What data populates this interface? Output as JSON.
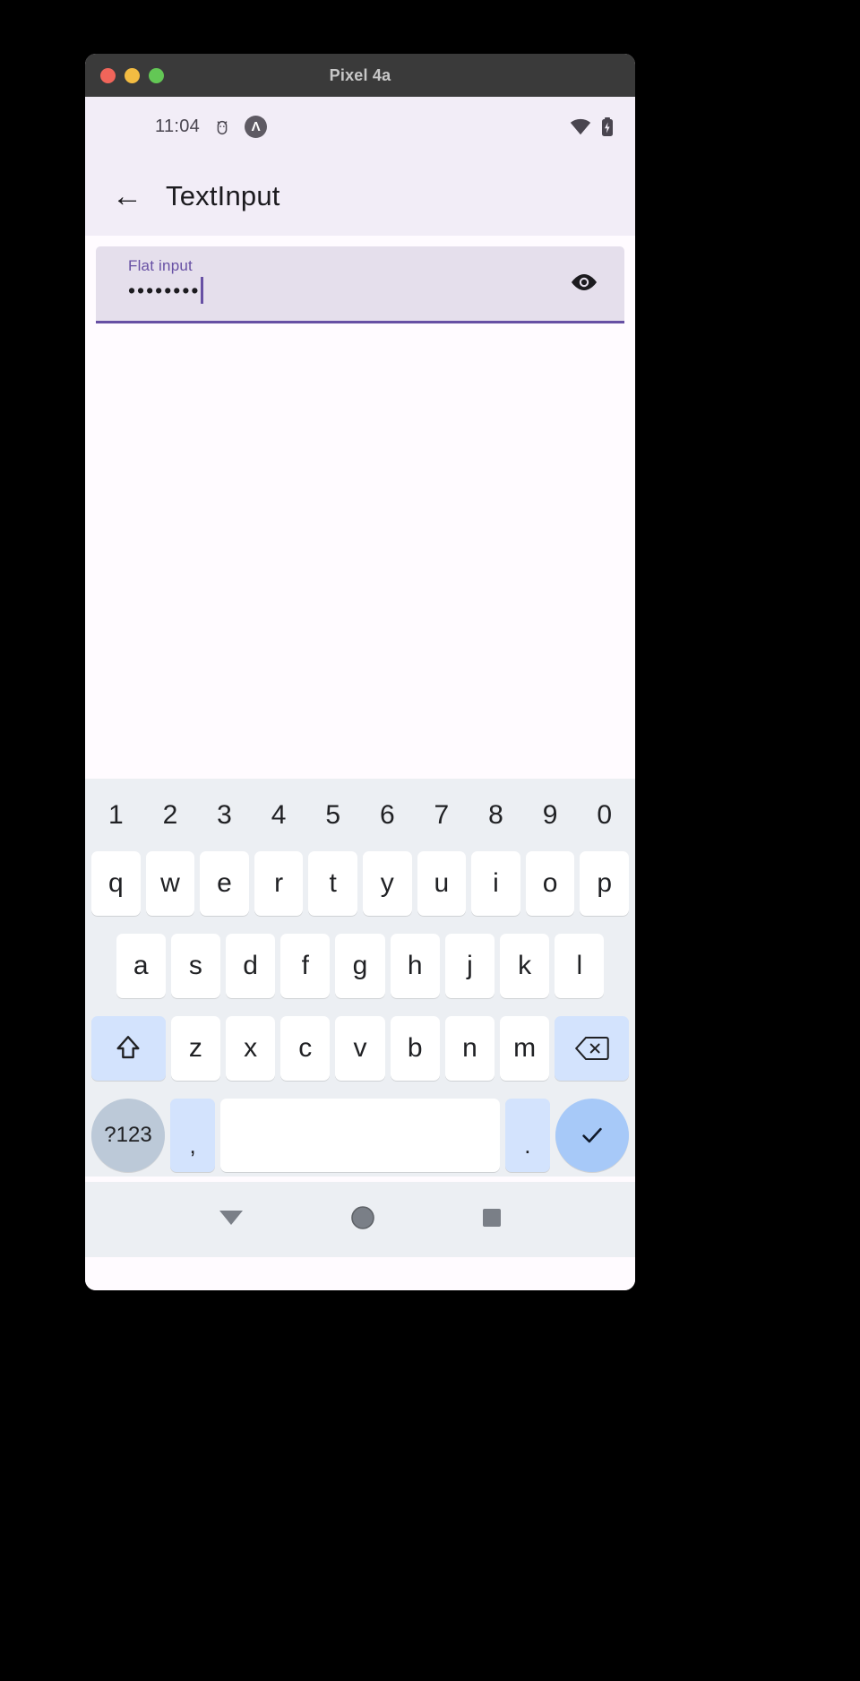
{
  "window": {
    "title": "Pixel 4a",
    "traffic_lights": [
      "close",
      "minimize",
      "zoom"
    ]
  },
  "status_bar": {
    "time": "11:04",
    "icons": [
      "android-bug-icon",
      "expo-circle-icon",
      "wifi-icon",
      "battery-icon"
    ],
    "expo_glyph": "Λ",
    "background": "#f2edf7"
  },
  "app_bar": {
    "back_icon": "←",
    "title": "TextInput",
    "background": "#f2edf7"
  },
  "text_field": {
    "label": "Flat input",
    "value": "••••••••",
    "placeholder": "Flat input",
    "secure": true,
    "trailing_icon": "eye-icon",
    "background": "#e5dfec",
    "accent_color": "#6750a4",
    "focused": true
  },
  "keyboard": {
    "background": "#eceff3",
    "number_row": [
      "1",
      "2",
      "3",
      "4",
      "5",
      "6",
      "7",
      "8",
      "9",
      "0"
    ],
    "row1": [
      "q",
      "w",
      "e",
      "r",
      "t",
      "y",
      "u",
      "i",
      "o",
      "p"
    ],
    "row2": [
      "a",
      "s",
      "d",
      "f",
      "g",
      "h",
      "j",
      "k",
      "l"
    ],
    "row3": {
      "shift_icon": "shift-icon",
      "letters": [
        "z",
        "x",
        "c",
        "v",
        "b",
        "n",
        "m"
      ],
      "backspace_icon": "backspace-icon"
    },
    "row4": {
      "symbols_label": "?123",
      "comma": ",",
      "space": "",
      "period": ".",
      "enter_icon": "check-icon"
    },
    "mod_key_color": "#d3e3fd",
    "enter_key_color": "#a7c9f8",
    "symbols_key_color": "#bcc9d8"
  },
  "nav_bar": {
    "back_icon": "triangle-down-icon",
    "home_icon": "circle-icon",
    "recents_icon": "square-icon",
    "background": "#eceff3"
  }
}
